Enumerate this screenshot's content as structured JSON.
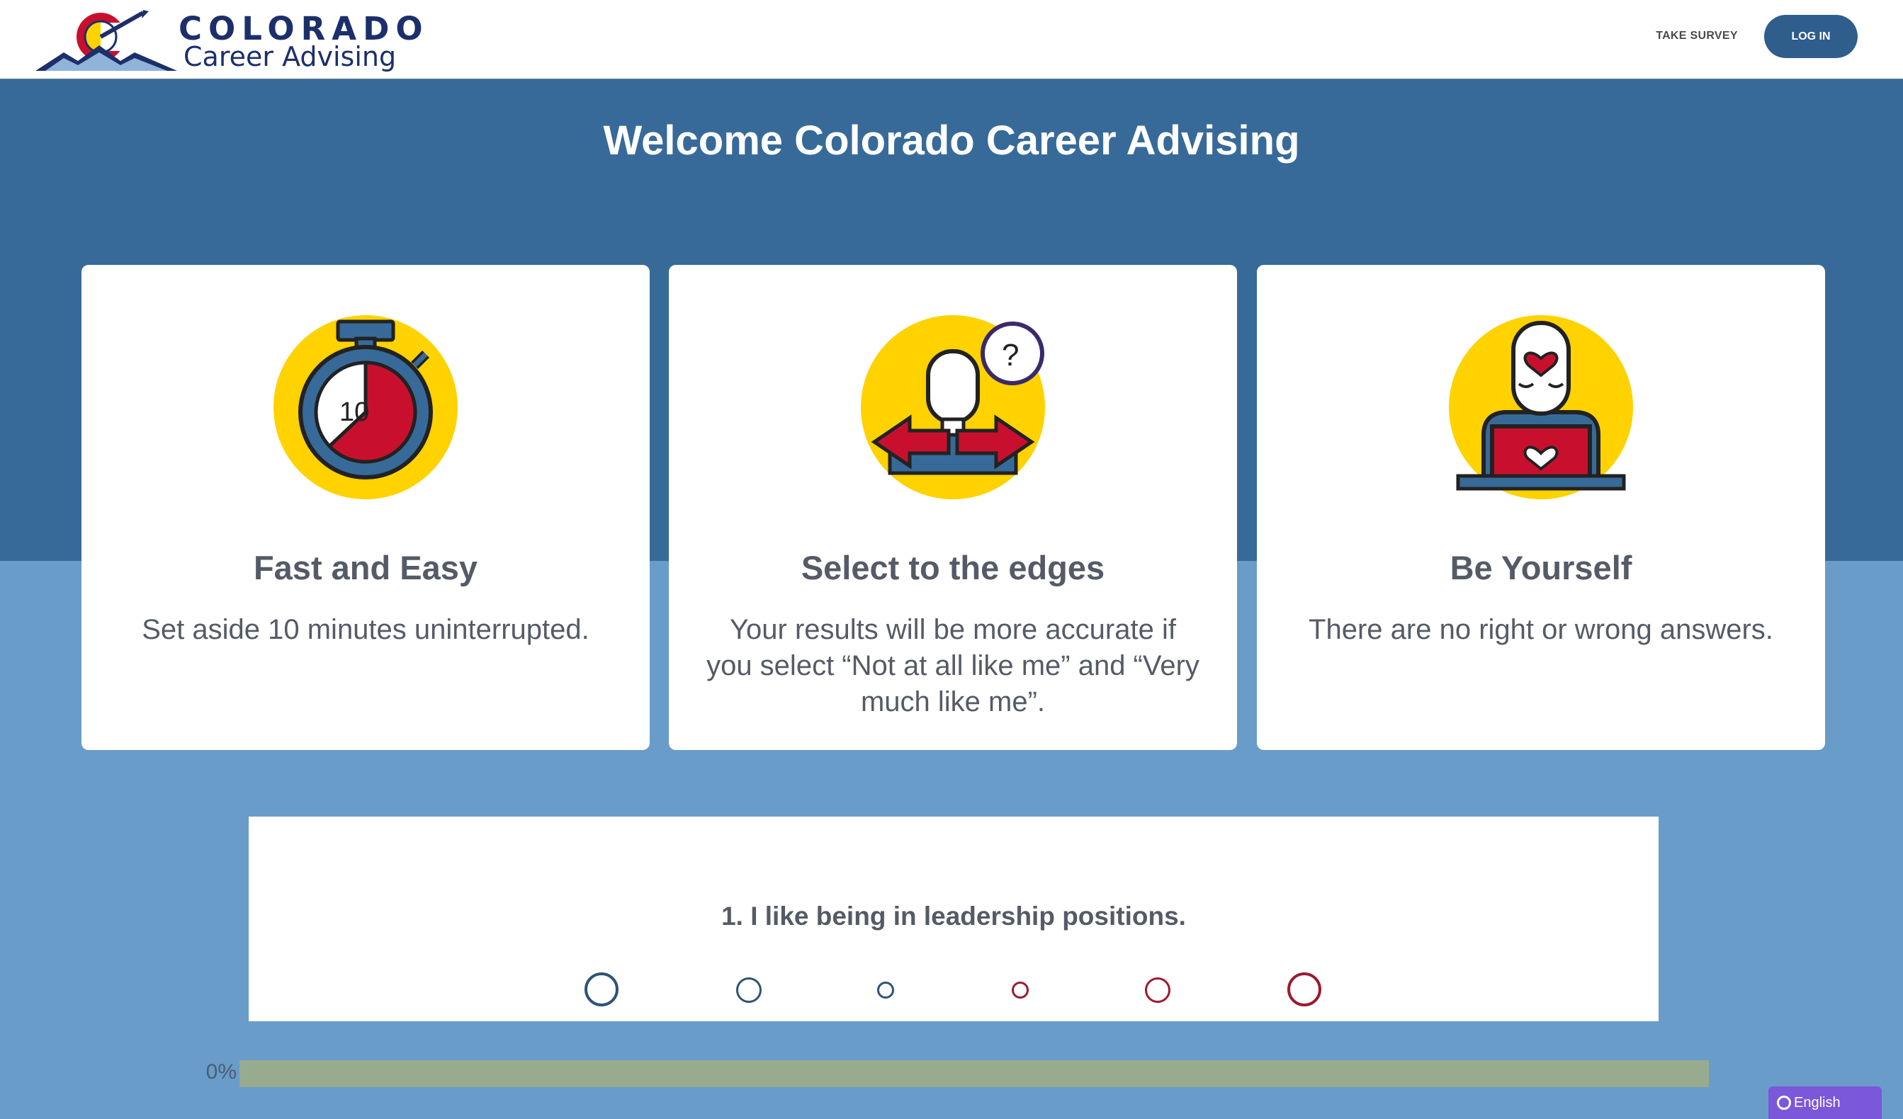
{
  "header": {
    "logo_title": "COLORADO",
    "logo_subtitle": "Career Advising",
    "nav_take_survey": "TAKE SURVEY",
    "login_label": "LOG IN"
  },
  "hero": {
    "title": "Welcome Colorado Career Advising"
  },
  "cards": [
    {
      "icon": "stopwatch-icon",
      "icon_text": "10",
      "title": "Fast and Easy",
      "text": "Set aside 10 minutes uninterrupted."
    },
    {
      "icon": "person-question-icon",
      "icon_text": "?",
      "title": "Select to the edges",
      "text": "Your results will be more accurate if you select “Not at all like me” and “Very much like me”."
    },
    {
      "icon": "person-heart-icon",
      "title": "Be Yourself",
      "text": "There are no right or wrong answers."
    }
  ],
  "survey": {
    "question": "1. I like being in leadership positions.",
    "options_count": 6
  },
  "progress": {
    "label": "0%",
    "value": 0
  },
  "language": {
    "label": "English"
  },
  "colors": {
    "navy": "#1d2f6b",
    "band_dark": "#376a98",
    "band_light": "#6a9cc9",
    "button": "#2f5d8c",
    "yellow": "#ffd200",
    "red": "#c8102e",
    "option_blue": "#2e5375",
    "option_red": "#9b1b2e",
    "language_purple": "#7b57d9"
  }
}
